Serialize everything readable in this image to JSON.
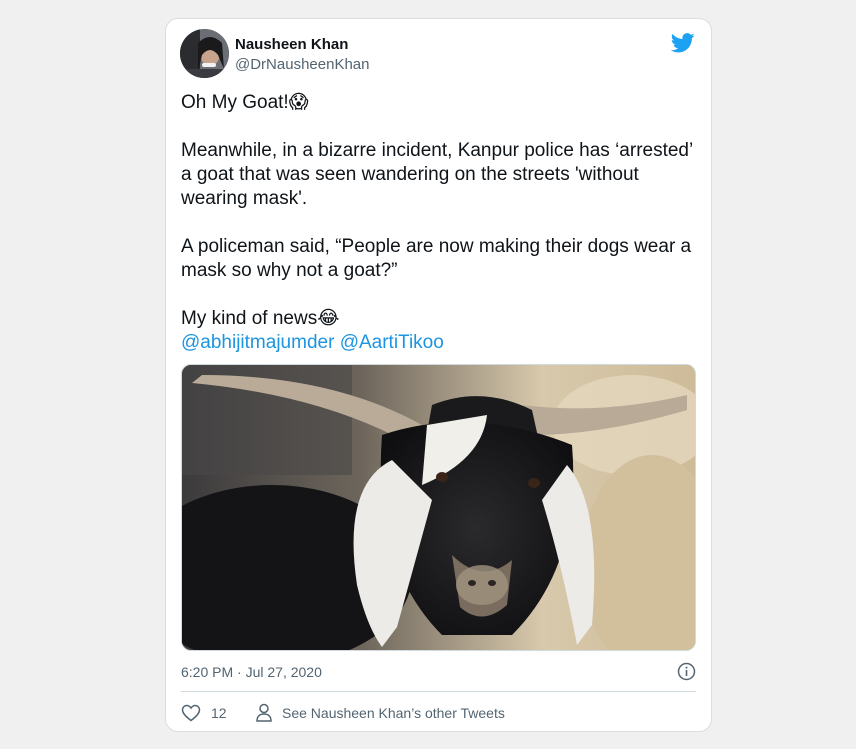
{
  "tweet": {
    "author_name": "Nausheen Khan",
    "author_handle": "@DrNausheenKhan",
    "text_lines": {
      "opener": "Oh My Goat!😱",
      "paragraph_1": "Meanwhile, in a bizarre incident, Kanpur police has ‘arrested’\na goat that was seen wandering on the streets 'without\nwearing mask'.",
      "paragraph_2": "A policeman said, “People are now making their dogs wear a\nmask so why not a goat?”",
      "closer": "My kind of news😂"
    },
    "mentions": [
      "@abhijitmajumder",
      "@AartiTikoo"
    ],
    "timestamp": "6:20 PM · Jul 27, 2020",
    "like_count": "12",
    "profile_link_label": "See Nausheen Khan’s other Tweets"
  },
  "icons": {
    "brand": "twitter-bird-icon",
    "like": "heart-icon",
    "profile": "person-icon",
    "info": "info-icon"
  },
  "colors": {
    "brand_blue": "#1da1f2",
    "link_blue": "#1b95e0",
    "secondary_text": "#536471",
    "page_background": "#f0f0f0"
  }
}
